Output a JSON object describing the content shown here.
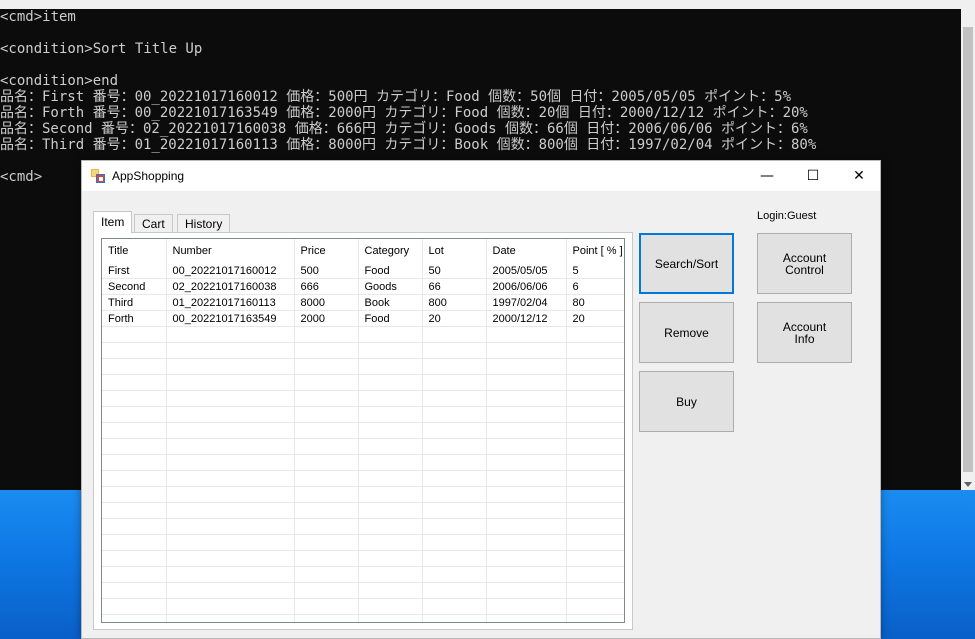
{
  "console": {
    "lines": [
      "<cmd>item",
      "",
      "<condition>Sort Title Up",
      "",
      "<condition>end",
      "品名：First 番号：00_20221017160012 価格：500円 カテゴリ：Food 個数：50個 日付：2005/05/05 ポイント：5%",
      "品名：Forth 番号：00_20221017163549 価格：2000円 カテゴリ：Food 個数：20個 日付：2000/12/12 ポイント：20%",
      "品名：Second 番号：02_20221017160038 価格：666円 カテゴリ：Goods 個数：66個 日付：2006/06/06 ポイント：6%",
      "品名：Third 番号：01_20221017160113 価格：8000円 カテゴリ：Book 個数：800個 日付：1997/02/04 ポイント：80%",
      "",
      "<cmd>"
    ]
  },
  "window": {
    "title": "AppShopping",
    "minimize": "—",
    "maximize": "☐",
    "close": "✕"
  },
  "tabs": [
    {
      "label": "Item",
      "active": true
    },
    {
      "label": "Cart",
      "active": false
    },
    {
      "label": "History",
      "active": false
    }
  ],
  "table": {
    "columns": [
      "Title",
      "Number",
      "Price",
      "Category",
      "Lot",
      "Date",
      "Point [ % ]"
    ],
    "rows": [
      [
        "First",
        "00_20221017160012",
        "500",
        "Food",
        "50",
        "2005/05/05",
        "5"
      ],
      [
        "Second",
        "02_20221017160038",
        "666",
        "Goods",
        "66",
        "2006/06/06",
        "6"
      ],
      [
        "Third",
        "01_20221017160113",
        "8000",
        "Book",
        "800",
        "1997/02/04",
        "80"
      ],
      [
        "Forth",
        "00_20221017163549",
        "2000",
        "Food",
        "20",
        "2000/12/12",
        "20"
      ]
    ]
  },
  "buttons": {
    "search_sort": "Search/Sort",
    "remove": "Remove",
    "buy": "Buy",
    "account_control": "Account\nControl",
    "account_info": "Account\nInfo"
  },
  "login": "Login:Guest",
  "colors": {
    "focus": "#0078d7",
    "console_bg": "#0c0c0c",
    "console_text": "#cccccc"
  }
}
